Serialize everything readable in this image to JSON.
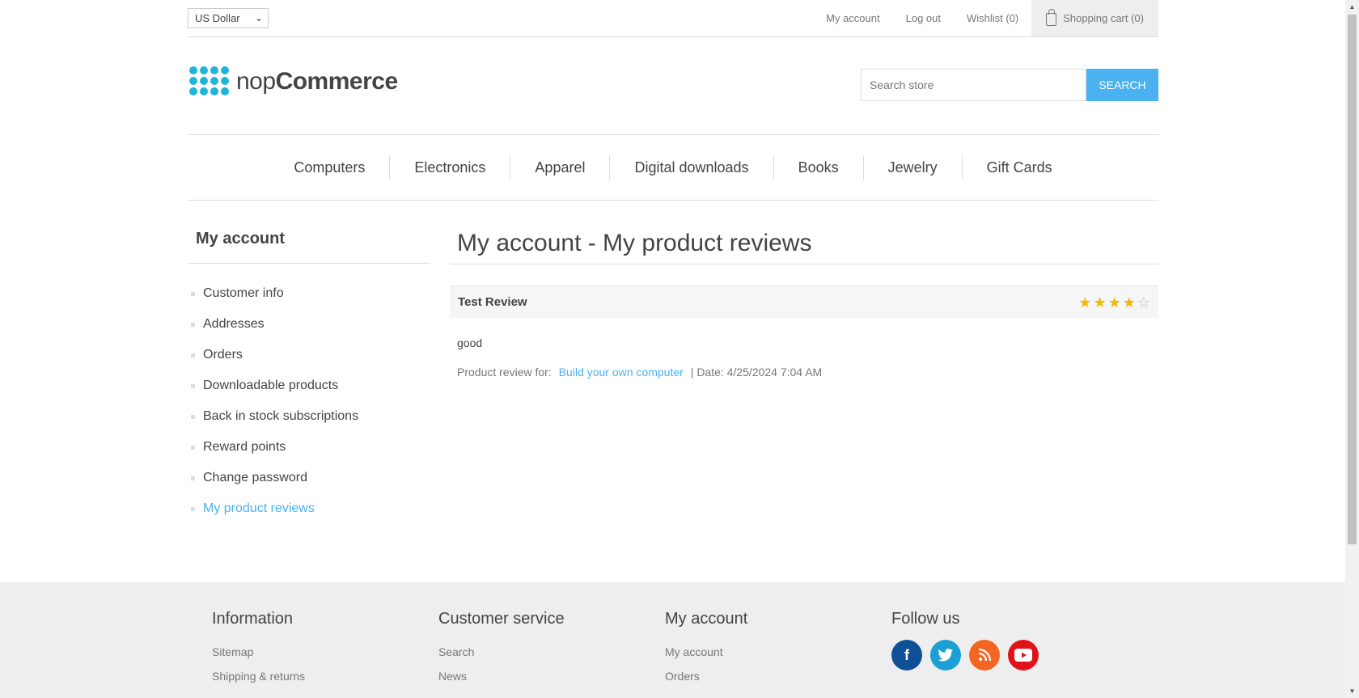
{
  "header": {
    "currency": "US Dollar",
    "links": {
      "my_account": "My account",
      "log_out": "Log out",
      "wishlist": "Wishlist (0)",
      "cart": "Shopping cart (0)"
    }
  },
  "logo": {
    "prefix": "nop",
    "suffix": "Commerce"
  },
  "search": {
    "placeholder": "Search store",
    "button": "SEARCH"
  },
  "nav": [
    "Computers",
    "Electronics",
    "Apparel",
    "Digital downloads",
    "Books",
    "Jewelry",
    "Gift Cards"
  ],
  "side": {
    "title": "My account",
    "items": [
      "Customer info",
      "Addresses",
      "Orders",
      "Downloadable products",
      "Back in stock subscriptions",
      "Reward points",
      "Change password",
      "My product reviews"
    ],
    "active_index": 7
  },
  "main": {
    "title": "My account - My product reviews",
    "review": {
      "title": "Test Review",
      "rating": 4,
      "max_rating": 5,
      "text": "good",
      "for_label": "Product review for:",
      "product": "Build your own computer",
      "date": "| Date: 4/25/2024 7:04 AM"
    }
  },
  "footer": {
    "information": {
      "title": "Information",
      "links": [
        "Sitemap",
        "Shipping & returns"
      ]
    },
    "customer_service": {
      "title": "Customer service",
      "links": [
        "Search",
        "News"
      ]
    },
    "my_account": {
      "title": "My account",
      "links": [
        "My account",
        "Orders"
      ]
    },
    "follow": {
      "title": "Follow us",
      "icons": [
        "facebook-icon",
        "twitter-icon",
        "rss-icon",
        "youtube-icon"
      ]
    }
  },
  "colors": {
    "accent": "#4ab2f1",
    "logo": "#20b5d8",
    "star": "#f5b800"
  }
}
